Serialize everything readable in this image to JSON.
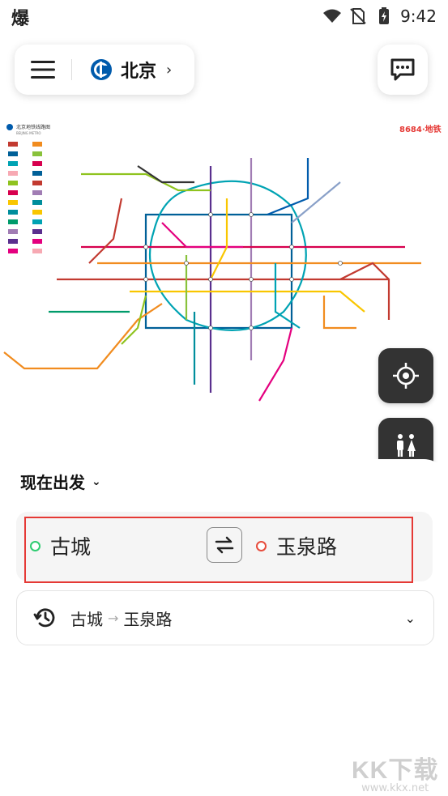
{
  "status_bar": {
    "app_glyph": "爆",
    "time": "9:42"
  },
  "city": {
    "name": "北京",
    "chevron": "›",
    "logo_icon": "beijing-subway-logo"
  },
  "map": {
    "title": "北京地铁线路图",
    "subtitle": "BEIJING METRO",
    "brand": "8684·地铁",
    "line_colors": [
      "#c23a30",
      "#006098",
      "#00a3b3",
      "#f7a9b3",
      "#8fc31f",
      "#d7004e",
      "#f9c600",
      "#008e9c",
      "#009b6b",
      "#a17db4",
      "#5a2f8e",
      "#e4007f",
      "#f18c1f",
      "#89c23b"
    ]
  },
  "tools": {
    "locate_icon": "locate-icon",
    "restroom_icon": "restroom-icon"
  },
  "depart": {
    "label": "现在出发",
    "chevron": "⌄"
  },
  "route": {
    "from": "古城",
    "to": "玉泉路",
    "from_color": "#2ecc71",
    "to_color": "#e74c3c",
    "swap_icon": "swap-icon"
  },
  "history": {
    "from": "古城",
    "arrow": "→",
    "to": "玉泉路",
    "chevron": "⌄"
  },
  "watermark": {
    "big": "KK下载",
    "small": "www.kkx.net"
  }
}
